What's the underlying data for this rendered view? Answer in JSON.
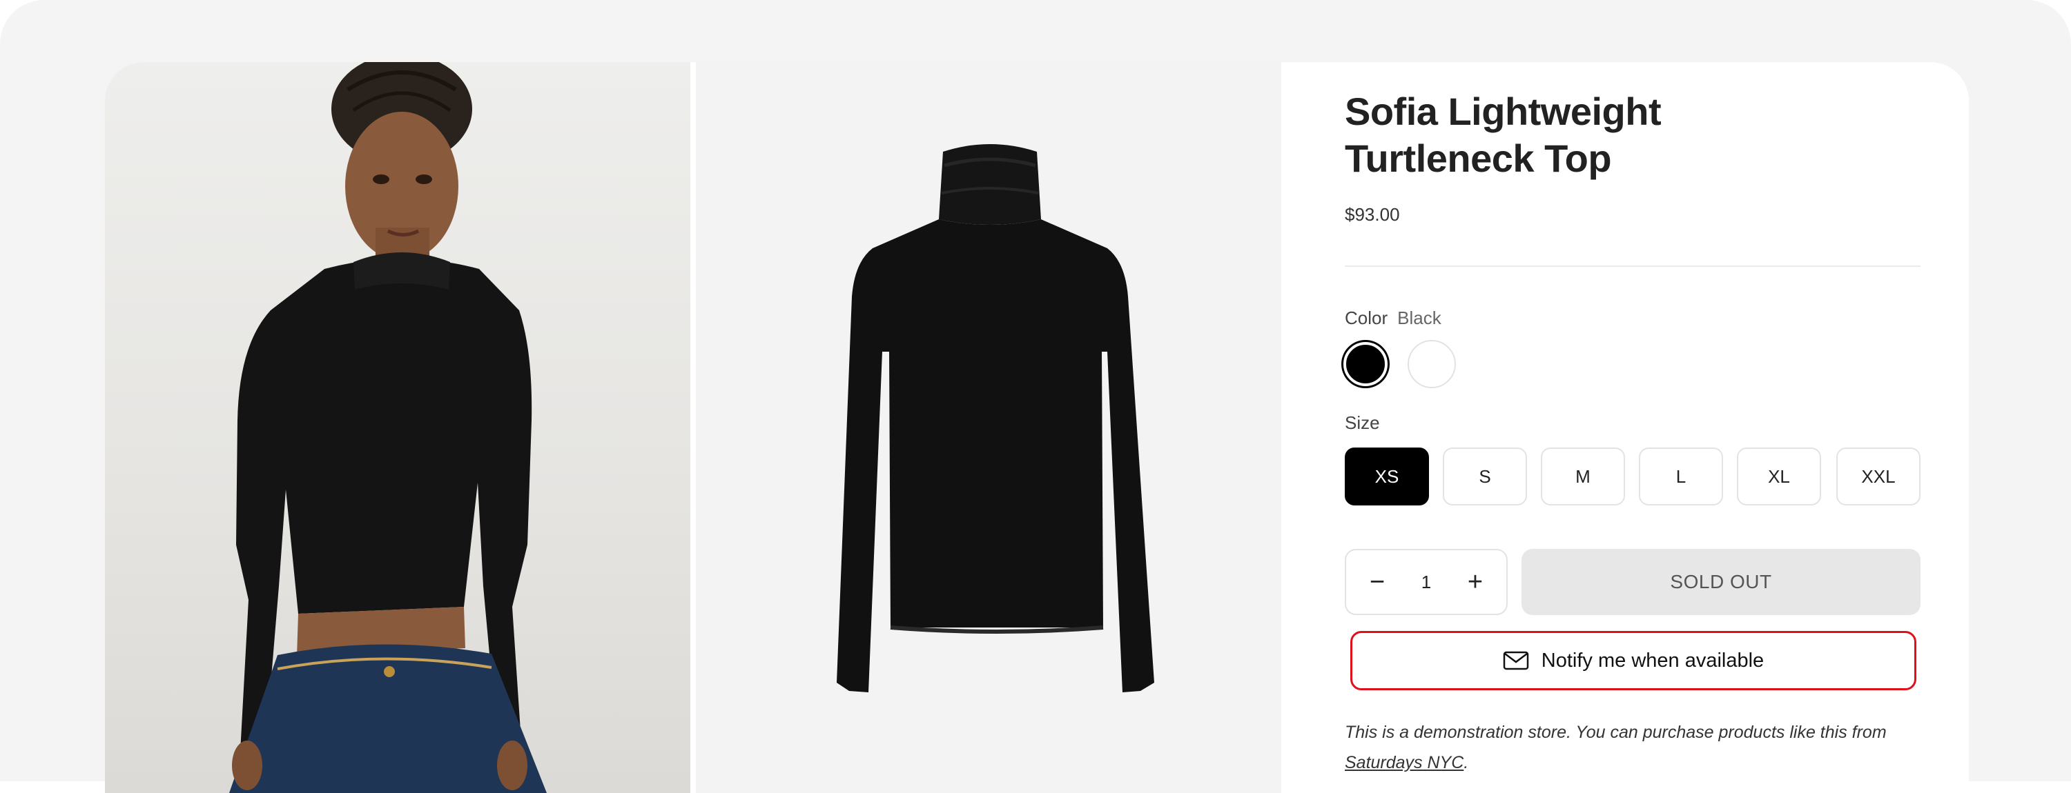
{
  "product": {
    "title": "Sofia Lightweight Turtleneck Top",
    "price": "$93.00"
  },
  "images": [
    {
      "description": "model wearing black turtleneck",
      "icon": "model-photo"
    },
    {
      "description": "black turtleneck product shot",
      "icon": "product-photo"
    }
  ],
  "color": {
    "label": "Color",
    "selected": "Black",
    "swatches": [
      {
        "name": "Black",
        "hex": "#000000",
        "selected": true
      },
      {
        "name": "White",
        "hex": "#ffffff",
        "selected": false
      }
    ]
  },
  "size": {
    "label": "Size",
    "options": [
      "XS",
      "S",
      "M",
      "L",
      "XL",
      "XXL"
    ],
    "selected": "XS"
  },
  "quantity": {
    "minus_symbol": "−",
    "value": "1",
    "plus_symbol": "+"
  },
  "buttons": {
    "sold_out": "SOLD OUT",
    "notify": "Notify me when available",
    "notify_icon": "envelope-icon"
  },
  "notice": {
    "text": "This is a demonstration store. You can purchase products like this from ",
    "link": "Saturdays NYC",
    "end": "."
  },
  "colors": {
    "page_bg": "#f4f4f4",
    "accent_red": "#e0101a",
    "soldout_bg": "#e7e7e7",
    "active_size_bg": "#000000"
  }
}
